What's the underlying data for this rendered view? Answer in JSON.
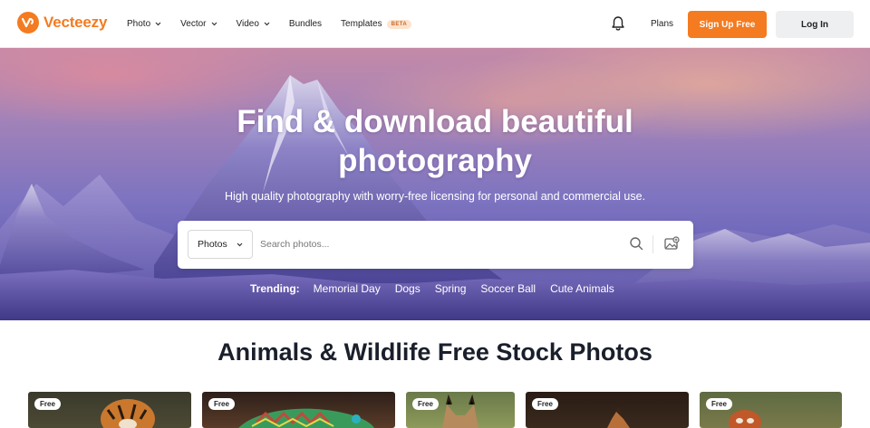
{
  "brand": {
    "name": "Vecteezy",
    "accent": "#f47b20"
  },
  "nav": {
    "menu": [
      {
        "label": "Photo",
        "has_dropdown": true
      },
      {
        "label": "Vector",
        "has_dropdown": true
      },
      {
        "label": "Video",
        "has_dropdown": true
      },
      {
        "label": "Bundles",
        "has_dropdown": false
      },
      {
        "label": "Templates",
        "has_dropdown": false,
        "badge": "BETA"
      }
    ],
    "notifications_icon": "bell-icon",
    "plans": "Plans",
    "signup": "Sign Up Free",
    "login": "Log In"
  },
  "hero": {
    "title_line1": "Find & download beautiful",
    "title_line2": "photography",
    "subtitle": "High quality photography with worry-free licensing for personal and commercial use.",
    "search": {
      "type_selected": "Photos",
      "placeholder": "Search photos...",
      "search_icon": "search-icon",
      "image_search_icon": "image-search-icon"
    },
    "trending": {
      "label": "Trending:",
      "tags": [
        "Memorial Day",
        "Dogs",
        "Spring",
        "Soccer Ball",
        "Cute Animals"
      ]
    }
  },
  "section": {
    "title": "Animals & Wildlife Free Stock Photos",
    "items": [
      {
        "badge": "Free",
        "subject": "tiger"
      },
      {
        "badge": "Free",
        "subject": "chameleon"
      },
      {
        "badge": "Free",
        "subject": "lynx"
      },
      {
        "badge": "Free",
        "subject": "fox"
      },
      {
        "badge": "Free",
        "subject": "red panda"
      }
    ]
  }
}
